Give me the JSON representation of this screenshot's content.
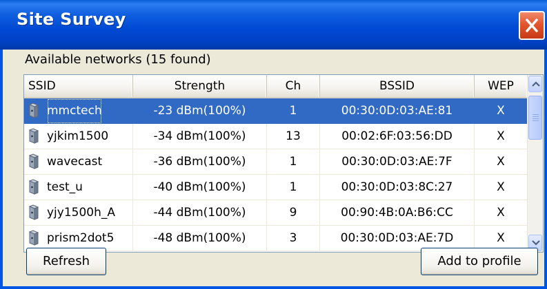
{
  "window": {
    "title": "Site Survey"
  },
  "caption": "Available networks  (15 found)",
  "columns": [
    "SSID",
    "Strength",
    "Ch",
    "BSSID",
    "WEP"
  ],
  "rows": [
    {
      "ssid": "mmctech",
      "strength": "-23 dBm(100%)",
      "ch": "1",
      "bssid": "00:30:0D:03:AE:81",
      "wep": "X",
      "selected": true
    },
    {
      "ssid": "yjkim1500",
      "strength": "-34 dBm(100%)",
      "ch": "13",
      "bssid": "00:02:6F:03:56:DD",
      "wep": "X"
    },
    {
      "ssid": "wavecast",
      "strength": "-36 dBm(100%)",
      "ch": "1",
      "bssid": "00:30:0D:03:AE:7F",
      "wep": "X"
    },
    {
      "ssid": "test_u",
      "strength": "-40 dBm(100%)",
      "ch": "1",
      "bssid": "00:30:0D:03:8C:27",
      "wep": "X"
    },
    {
      "ssid": "yjy1500h_A",
      "strength": "-44 dBm(100%)",
      "ch": "9",
      "bssid": "00:90:4B:0A:B6:CC",
      "wep": "X"
    },
    {
      "ssid": "prism2dot5",
      "strength": "-48 dBm(100%)",
      "ch": "3",
      "bssid": "00:30:0D:03:AE:7D",
      "wep": "X"
    }
  ],
  "buttons": {
    "refresh": "Refresh",
    "add_to_profile": "Add to profile"
  },
  "colors": {
    "titlebar": "#0048d2",
    "selection": "#316ac5",
    "close": "#e3552f"
  },
  "icons": {
    "row": "access-point-icon",
    "close": "close-icon"
  }
}
